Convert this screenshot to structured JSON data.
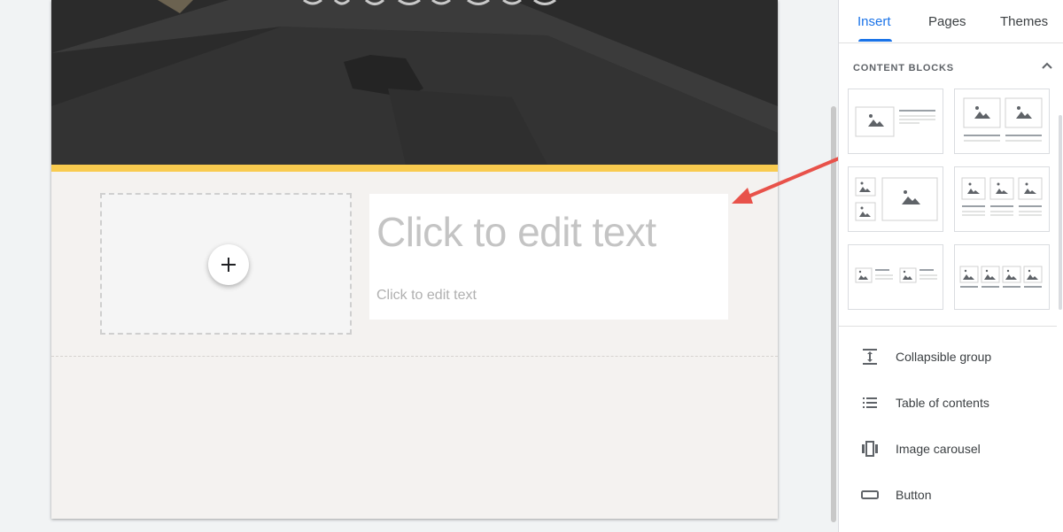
{
  "theme": {
    "accent": "#f9cb4f",
    "tab_active": "#1a73e8",
    "arrow": "#e8524a"
  },
  "page": {
    "placeholder_title": "Click to edit text",
    "placeholder_body": "Click to edit text"
  },
  "panel": {
    "tabs": [
      {
        "label": "Insert",
        "active": true
      },
      {
        "label": "Pages",
        "active": false
      },
      {
        "label": "Themes",
        "active": false
      }
    ],
    "section_title": "CONTENT BLOCKS",
    "tools": [
      {
        "label": "Collapsible group",
        "icon": "collapsible-group-icon"
      },
      {
        "label": "Table of contents",
        "icon": "table-of-contents-icon"
      },
      {
        "label": "Image carousel",
        "icon": "image-carousel-icon"
      },
      {
        "label": "Button",
        "icon": "button-icon"
      }
    ]
  }
}
